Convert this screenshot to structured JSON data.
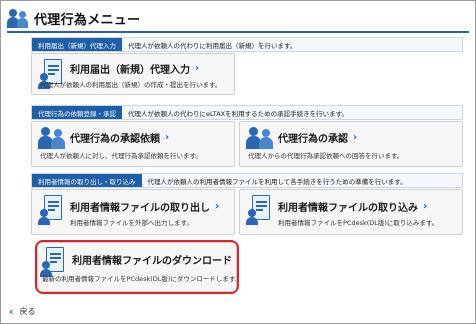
{
  "header": {
    "title": "代理行為メニュー",
    "icon": "people-icon"
  },
  "sections": [
    {
      "tag": "利用届出（新規）代理入力",
      "desc": "代理人が依頼人の代わりに利用届出（新規）を行います。"
    },
    {
      "tag": "代理行為の依頼登録・承認",
      "desc": "代理人が依頼人の代わりにeLTAXを利用するための承認手続きを行います。"
    },
    {
      "tag": "利用者情報の取り出し・取り込み",
      "desc": "代理人が依頼人の利用者情報ファイルを利用して各手続きを行うための準備を行います。"
    }
  ],
  "cards": {
    "registration": {
      "title": "利用届出（新規）代理入力",
      "desc": "代理人が依頼人の利用届出（新規）の作成・提出を行います。",
      "icon": "document-person-icon"
    },
    "approval_request": {
      "title": "代理行為の承認依頼",
      "desc": "代理人が依頼人に対し、代理行為承認依頼を行います。",
      "icon": "people-icon"
    },
    "approval": {
      "title": "代理行為の承認",
      "desc": "代理人からの代理行為承認依頼への回答を行います。",
      "icon": "people-icon"
    },
    "export": {
      "title": "利用者情報ファイルの取り出し",
      "desc": "利用者情報ファイルを外部へ出力します。",
      "icon": "document-person-icon"
    },
    "import": {
      "title": "利用者情報ファイルの取り込み",
      "desc": "利用者情報ファイルをPCdesk(DL版)に取り込みます。",
      "icon": "document-person-icon"
    },
    "download": {
      "title": "利用者情報ファイルのダウンロード",
      "desc": "最新の利用者情報ファイルをPCdesk(DL版)にダウンロードします。",
      "icon": "document-person-icon"
    }
  },
  "footer": {
    "back_label": "戻る"
  },
  "colors": {
    "accent": "#1f63b2",
    "section_tag": "#1f5fa8",
    "highlight": "#e0202a"
  }
}
